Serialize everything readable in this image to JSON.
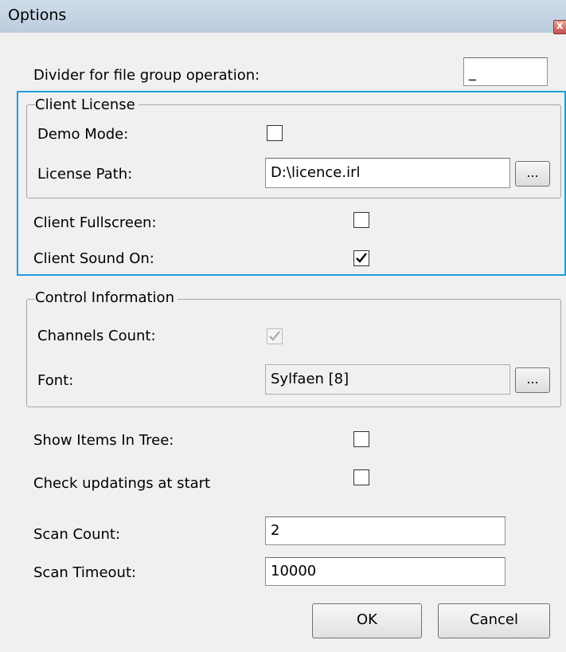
{
  "window": {
    "title": "Options",
    "close_glyph": "x"
  },
  "divider": {
    "label": "Divider for file group operation:",
    "value": "_"
  },
  "client_license": {
    "group_label": "Client License",
    "demo_mode_label": "Demo Mode:",
    "demo_mode_checked": false,
    "license_path_label": "License Path:",
    "license_path_value": "D:\\licence.irl",
    "browse_label": "..."
  },
  "client_fullscreen": {
    "label": "Client Fullscreen:",
    "checked": false
  },
  "client_sound": {
    "label": "Client Sound On:",
    "checked": true
  },
  "control_info": {
    "group_label": "Control Information",
    "channels_count_label": "Channels Count:",
    "channels_count_checked": true,
    "font_label": "Font:",
    "font_value": "Sylfaen [8]",
    "browse_label": "..."
  },
  "show_items": {
    "label": "Show Items In Tree:",
    "checked": false
  },
  "check_updates": {
    "label": "Check updatings at start",
    "checked": false
  },
  "scan_count": {
    "label": "Scan Count:",
    "value": "2"
  },
  "scan_timeout": {
    "label": "Scan Timeout:",
    "value": "10000"
  },
  "buttons": {
    "ok": "OK",
    "cancel": "Cancel"
  },
  "colors": {
    "highlight": "#1e9fd9",
    "background": "#f0f0f0"
  },
  "icons": {
    "check": "check-icon",
    "close": "close-icon"
  }
}
